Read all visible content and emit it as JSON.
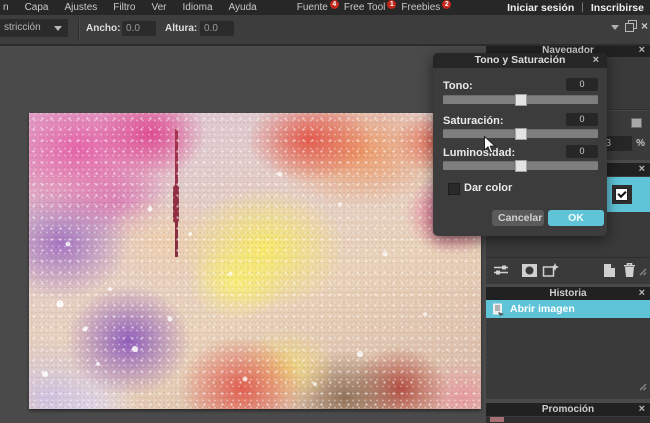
{
  "ui": {
    "close_glyph": "×"
  },
  "menu": {
    "items": [
      {
        "label": "n"
      },
      {
        "label": "Capa"
      },
      {
        "label": "Ajustes"
      },
      {
        "label": "Filtro"
      },
      {
        "label": "Ver"
      },
      {
        "label": "Idioma"
      },
      {
        "label": "Ayuda"
      },
      {
        "label": "Fuente",
        "badge": "4"
      },
      {
        "label": "Free Tool",
        "badge": "1"
      },
      {
        "label": "Freebies",
        "badge": "2"
      }
    ],
    "signin": "Iniciar sesión",
    "divider": "|",
    "signup": "Inscribirse"
  },
  "toolbar": {
    "constraint_value": "stricción",
    "width_label": "Ancho:",
    "width_value": "0.0",
    "height_label": "Altura:",
    "height_value": "0.0"
  },
  "dialog": {
    "title": "Tono y Saturación",
    "sliders": [
      {
        "label": "Tono:",
        "value": "0"
      },
      {
        "label": "Saturación:",
        "value": "0"
      },
      {
        "label": "Luminosidad:",
        "value": "0"
      }
    ],
    "checkbox_label": "Dar color",
    "cancel_label": "Cancelar",
    "ok_label": "OK"
  },
  "panels": {
    "navigator": {
      "title": "Navegador",
      "zoom_value": "3",
      "zoom_unit": "%"
    },
    "history": {
      "title": "Historia",
      "items": [
        {
          "label": "Abrir imagen"
        }
      ]
    },
    "promo": {
      "title": "Promoción"
    }
  },
  "colors": {
    "accent_cyan": "#5fc4d8",
    "badge_red": "#c4281c",
    "panel_bg": "#3a3a3a",
    "titlebar_bg": "#212121"
  }
}
